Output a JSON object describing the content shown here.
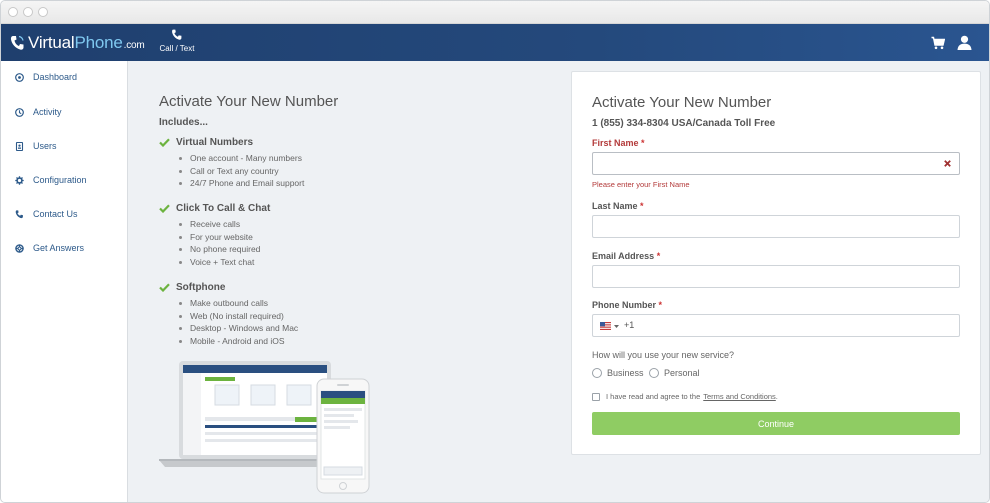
{
  "app": {
    "logo": {
      "part1": "Virtual",
      "part2": "Phone",
      "part3": ".com"
    },
    "header_tab": "Call / Text",
    "icons": [
      "phone-handset-icon",
      "cart-icon",
      "user-icon"
    ],
    "colors": {
      "header": "#24497c",
      "accent_green": "#8fcc63",
      "link_blue": "#2d5a8a",
      "error_red": "#b33a3a"
    }
  },
  "sidebar": {
    "items": [
      {
        "label": "Dashboard",
        "icon": "dashboard-icon"
      },
      {
        "label": "Activity",
        "icon": "activity-icon"
      },
      {
        "label": "Users",
        "icon": "users-icon"
      },
      {
        "label": "Configuration",
        "icon": "gear-icon"
      },
      {
        "label": "Contact Us",
        "icon": "phone-icon"
      },
      {
        "label": "Get Answers",
        "icon": "lifebuoy-icon"
      }
    ]
  },
  "intro": {
    "title": "Activate Your New Number",
    "subtitle": "Includes...",
    "features": [
      {
        "title": "Virtual Numbers",
        "items": [
          "One account - Many numbers",
          "Call or Text any country",
          "24/7 Phone and Email support"
        ]
      },
      {
        "title": "Click To Call & Chat",
        "items": [
          "Receive calls",
          "For your website",
          "No phone required",
          "Voice + Text chat"
        ]
      },
      {
        "title": "Softphone",
        "items": [
          "Make outbound calls",
          "Web (No install required)",
          "Desktop - Windows and Mac",
          "Mobile - Android and iOS"
        ]
      }
    ]
  },
  "form": {
    "title": "Activate Your New Number",
    "number": "1 (855) 334-8304 USA/Canada Toll Free",
    "first_name": {
      "label": "First Name",
      "required": "*",
      "value": "",
      "error": "Please enter your First Name"
    },
    "last_name": {
      "label": "Last Name",
      "required": "*",
      "value": ""
    },
    "email": {
      "label": "Email Address",
      "required": "*",
      "value": ""
    },
    "phone": {
      "label": "Phone Number",
      "required": "*",
      "country": "US",
      "dial_code": "+1"
    },
    "usage_question": "How will you use your new service?",
    "usage_options": [
      "Business",
      "Personal"
    ],
    "agree_text": "I have read and agree to the",
    "agree_link": "Terms and Conditions",
    "agree_end": ".",
    "submit_label": "Continue"
  }
}
